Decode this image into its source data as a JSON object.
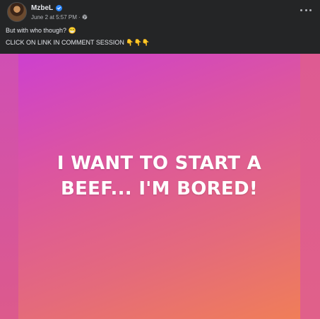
{
  "post": {
    "author": "MzbeL",
    "timestamp": "June 2 at 5:57 PM",
    "separator": "·",
    "audience_icon": "globe-icon",
    "verified_icon": "verified-badge-icon",
    "more_icon": "more-options-icon",
    "text_line_1": "But with who though? 😁",
    "text_line_2": "CLICK ON LINK IN COMMENT SESSION 👇👇👇"
  },
  "image": {
    "caption": "I WANT TO START A BEEF... I'M BORED!",
    "gradient_colors": [
      "#cd40cf",
      "#dc55a0",
      "#e46a7c",
      "#f07e58"
    ]
  },
  "colors": {
    "background": "#242526",
    "text_primary": "#e4e6eb",
    "text_secondary": "#b0b3b8",
    "verified": "#2d88ff"
  }
}
